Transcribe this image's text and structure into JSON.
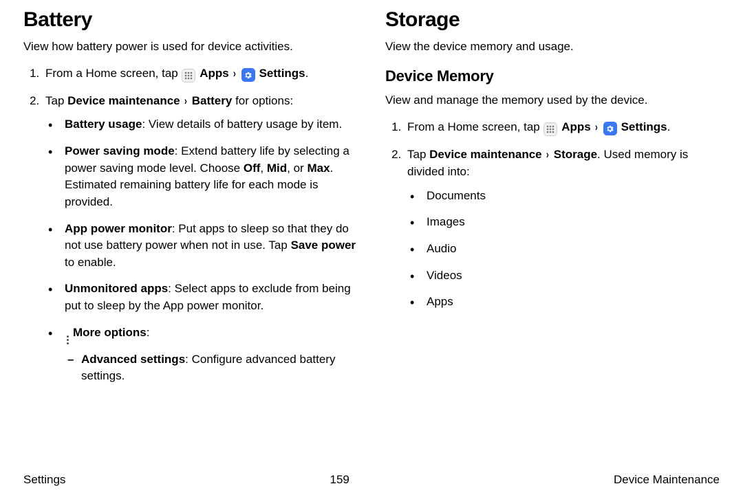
{
  "left": {
    "title": "Battery",
    "intro": "View how battery power is used for device activities.",
    "step1_prefix": "From a Home screen, tap ",
    "apps_label": "Apps",
    "settings_label": "Settings",
    "step2_prefix": "Tap ",
    "step2_path1": "Device maintenance",
    "step2_path2": "Battery",
    "step2_suffix": " for options:",
    "bullets": {
      "b1_label": "Battery usage",
      "b1_text": ": View details of battery usage by item.",
      "b2_label": "Power saving mode",
      "b2_text_a": ": Extend battery life by selecting a power saving mode level. Choose ",
      "b2_off": "Off",
      "b2_mid": "Mid",
      "b2_or": ", or ",
      "b2_comma": ", ",
      "b2_max": "Max",
      "b2_text_b": ". Estimated remaining battery life for each mode is provided.",
      "b3_label": "App power monitor",
      "b3_text_a": ": Put apps to sleep so that they do not use battery power when not in use. Tap ",
      "b3_save": "Save power",
      "b3_text_b": " to enable.",
      "b4_label": "Unmonitored apps",
      "b4_text": ": Select apps to exclude from being put to sleep by the App power monitor.",
      "b5_label": "More options",
      "b5_colon": ":",
      "b5_sub_label": "Advanced settings",
      "b5_sub_text": ": Configure advanced battery settings."
    }
  },
  "right": {
    "title": "Storage",
    "intro": "View the device memory and usage.",
    "subheading": "Device Memory",
    "sub_intro": "View and manage the memory used by the device.",
    "step1_prefix": "From a Home screen, tap ",
    "apps_label": "Apps",
    "settings_label": "Settings",
    "step2_prefix": "Tap ",
    "step2_path1": "Device maintenance",
    "step2_path2": "Storage",
    "step2_suffix": ". Used memory is divided into:",
    "categories": {
      "c1": "Documents",
      "c2": "Images",
      "c3": "Audio",
      "c4": "Videos",
      "c5": "Apps"
    }
  },
  "footer": {
    "left": "Settings",
    "center": "159",
    "right": "Device Maintenance"
  },
  "glyphs": {
    "chevron": "›",
    "period": "."
  }
}
